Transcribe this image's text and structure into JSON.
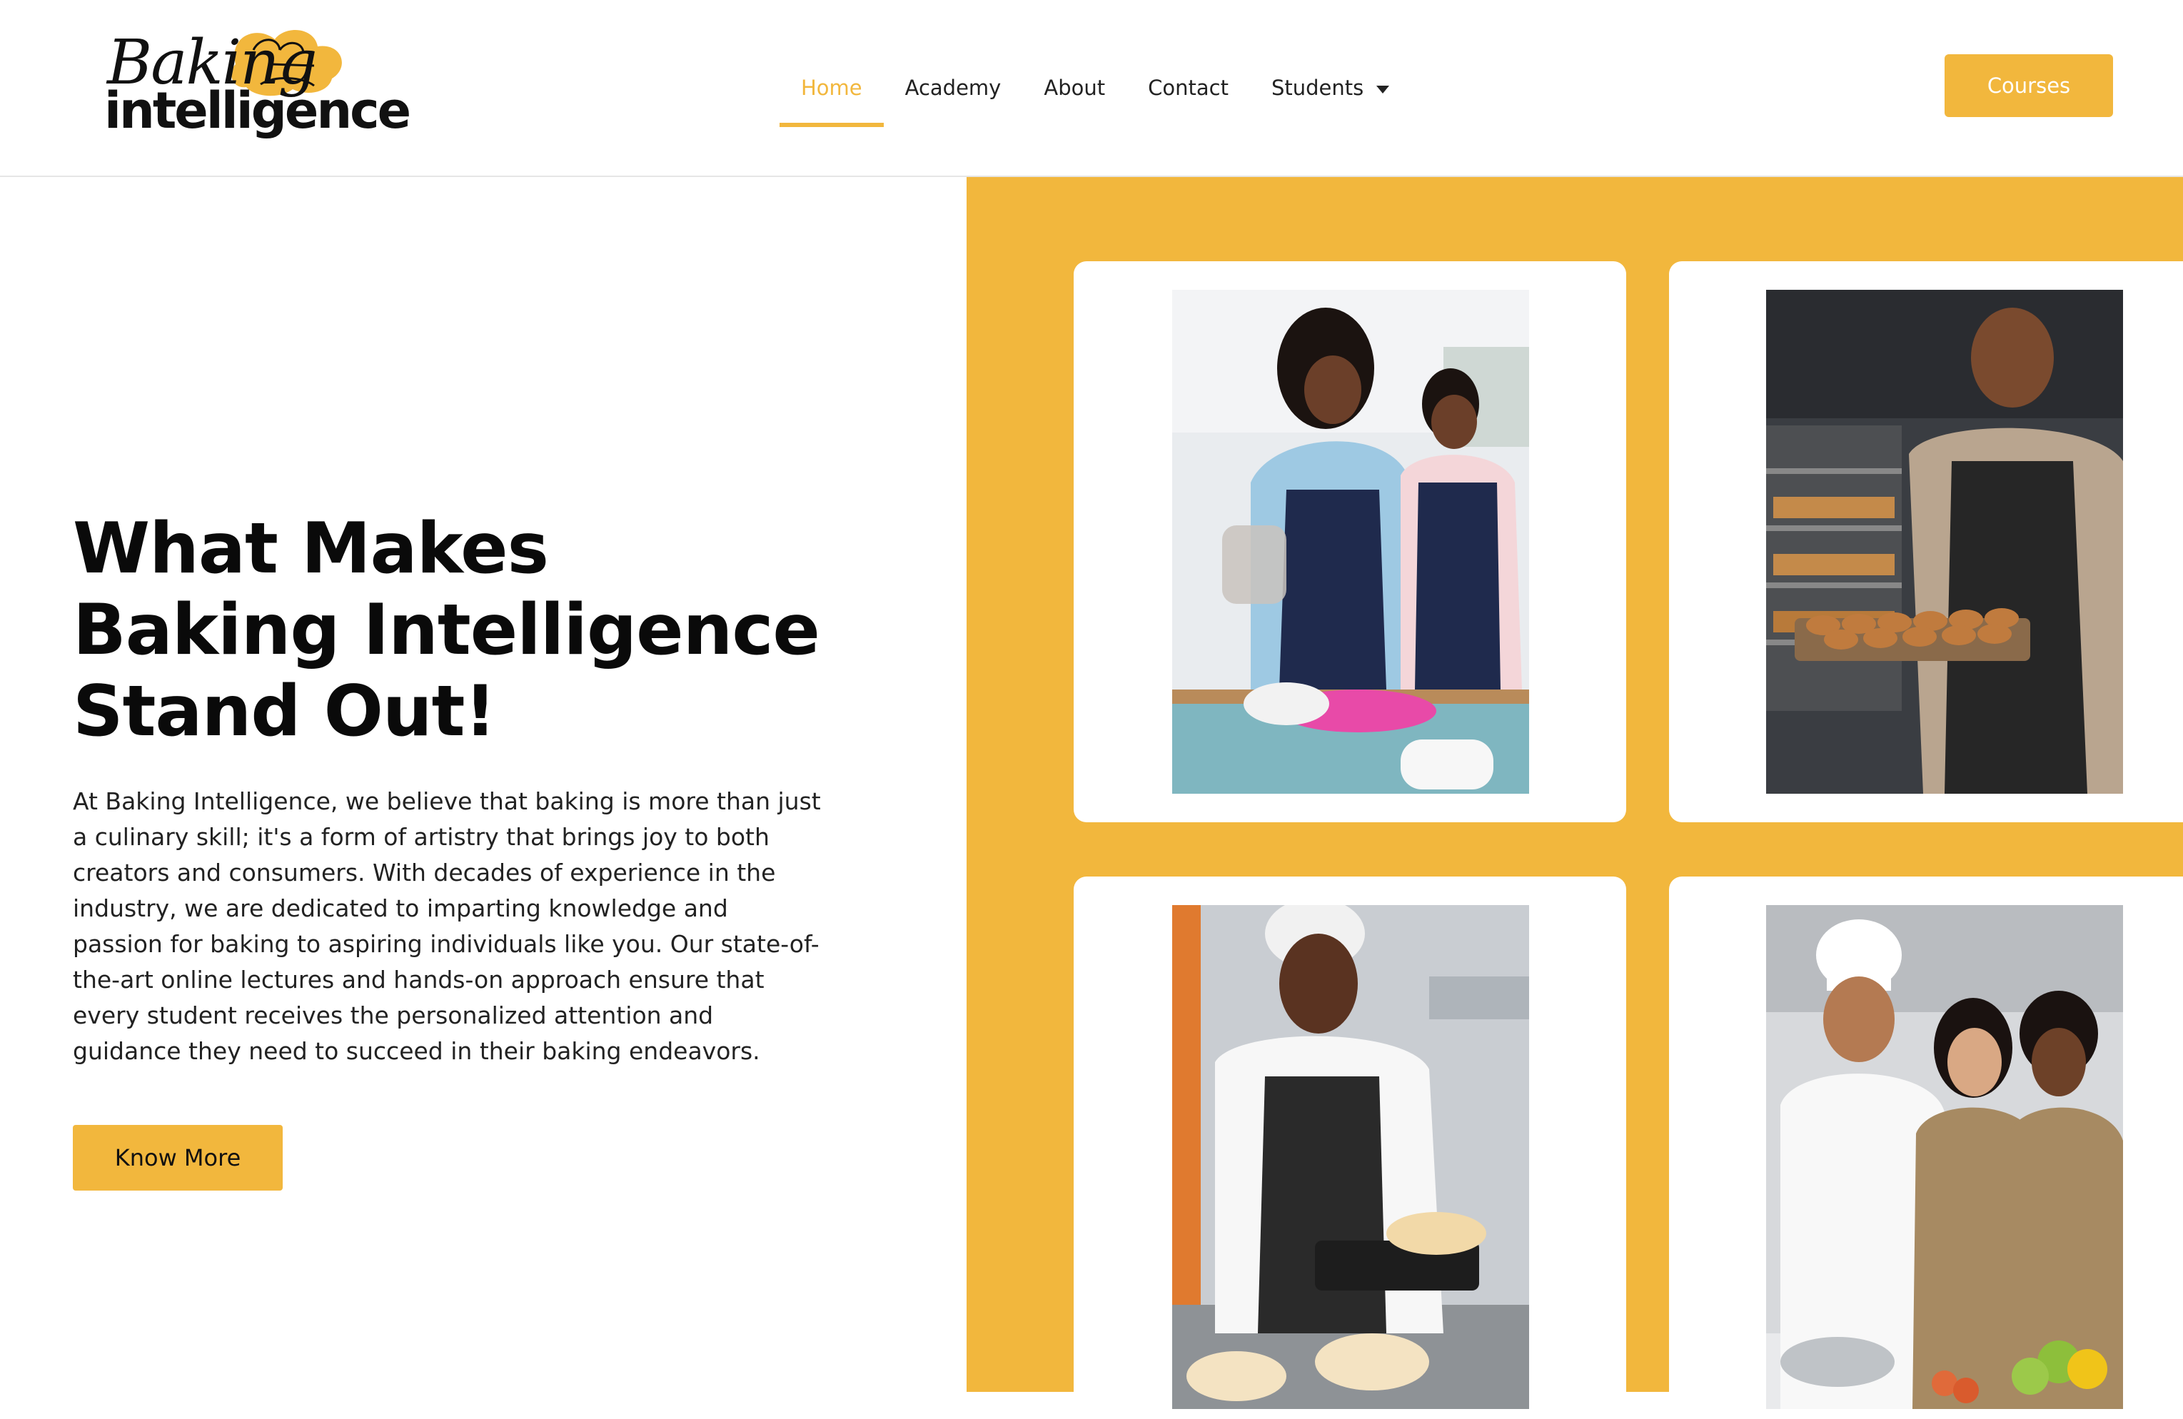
{
  "header": {
    "logo": {
      "line1": "Baking",
      "line2": "intelligence",
      "accent": "#f2b73d"
    },
    "nav": [
      {
        "label": "Home",
        "active": true
      },
      {
        "label": "Academy",
        "active": false
      },
      {
        "label": "About",
        "active": false
      },
      {
        "label": "Contact",
        "active": false
      },
      {
        "label": "Students",
        "active": false,
        "dropdown": true,
        "icon": "chevron-down-icon"
      }
    ],
    "cta_label": "Courses"
  },
  "hero": {
    "headline": "What Makes Baking Intelligence Stand Out!",
    "body": "At Baking Intelligence, we believe that baking is more than just a culinary skill; it's a form of artistry that brings joy to both creators and consumers. With decades of experience in the industry, we are dedicated to imparting knowledge and passion for baking to aspiring individuals like you. Our state-of-the-art online lectures and hands-on approach ensure that every student receives the personalized attention and guidance they need to succeed in their baking endeavors.",
    "button_label": "Know More"
  },
  "gallery": {
    "photos": [
      {
        "subject": "two women baking at a table"
      },
      {
        "subject": "baker holding tray of pastries"
      },
      {
        "subject": "baker kneading dough"
      },
      {
        "subject": "chef with two smiling students"
      }
    ]
  },
  "colors": {
    "accent": "#f2b73d",
    "text": "#111111",
    "background": "#ffffff"
  }
}
